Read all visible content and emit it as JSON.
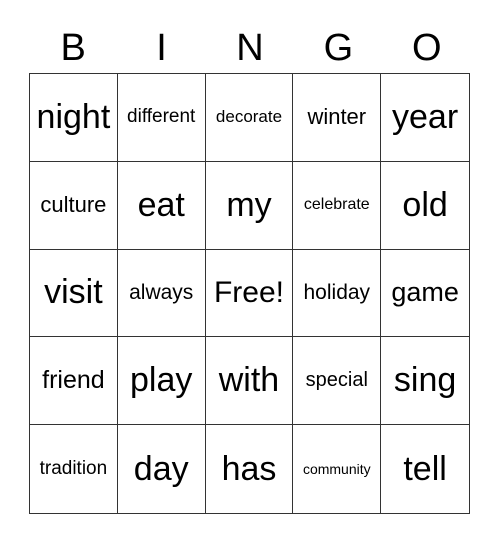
{
  "header": [
    "B",
    "I",
    "N",
    "G",
    "O"
  ],
  "cells": [
    [
      "night",
      "different",
      "decorate",
      "winter",
      "year"
    ],
    [
      "culture",
      "eat",
      "my",
      "celebrate",
      "old"
    ],
    [
      "visit",
      "always",
      "Free!",
      "holiday",
      "game"
    ],
    [
      "friend",
      "play",
      "with",
      "special",
      "sing"
    ],
    [
      "tradition",
      "day",
      "has",
      "community",
      "tell"
    ]
  ]
}
